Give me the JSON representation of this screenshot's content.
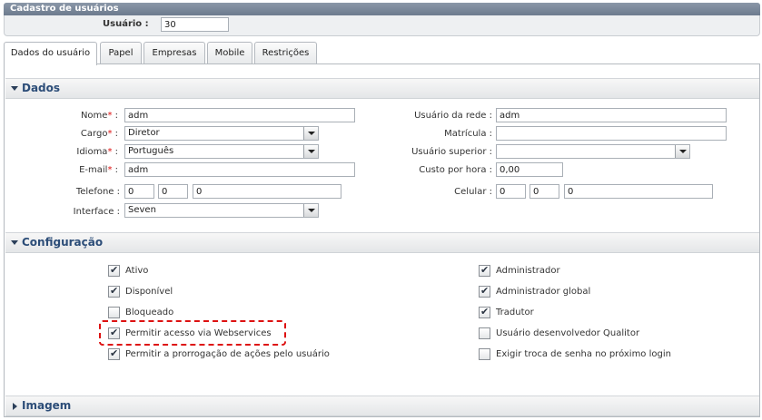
{
  "window": {
    "title": "Cadastro de usuários"
  },
  "userbar": {
    "label": "Usuário :",
    "value": "30"
  },
  "tabs": [
    {
      "label": "Dados do usuário",
      "active": true
    },
    {
      "label": "Papel"
    },
    {
      "label": "Empresas"
    },
    {
      "label": "Mobile"
    },
    {
      "label": "Restrições"
    }
  ],
  "sections": {
    "dados": {
      "title": "Dados"
    },
    "config": {
      "title": "Configuração"
    },
    "imagem": {
      "title": "Imagem"
    }
  },
  "form": {
    "nome": {
      "label": "Nome",
      "value": "adm"
    },
    "cargo": {
      "label": "Cargo",
      "value": "Diretor"
    },
    "idioma": {
      "label": "Idioma",
      "value": "Português"
    },
    "email": {
      "label": "E-mail",
      "value": "adm"
    },
    "telefone": {
      "label": "Telefone :",
      "v1": "0",
      "v2": "0",
      "v3": "0"
    },
    "interface": {
      "label": "Interface :",
      "value": "Seven"
    },
    "usuario_rede": {
      "label": "Usuário da rede :",
      "value": "adm"
    },
    "matricula": {
      "label": "Matrícula :",
      "value": ""
    },
    "usuario_superior": {
      "label": "Usuário superior :",
      "value": ""
    },
    "custo_hora": {
      "label": "Custo por hora :",
      "value": "0,00"
    },
    "celular": {
      "label": "Celular :",
      "v1": "0",
      "v2": "0",
      "v3": "0"
    }
  },
  "required_mark": "*",
  "colon": ":",
  "config": {
    "left": [
      {
        "label": "Ativo",
        "checked": true
      },
      {
        "label": "Disponível",
        "checked": true
      },
      {
        "label": "Bloqueado",
        "checked": false
      },
      {
        "label": "Permitir acesso via Webservices",
        "checked": true
      },
      {
        "label": "Permitir a prorrogação de ações pelo usuário",
        "checked": true
      }
    ],
    "right": [
      {
        "label": "Administrador",
        "checked": true
      },
      {
        "label": "Administrador global",
        "checked": true
      },
      {
        "label": "Tradutor",
        "checked": true
      },
      {
        "label": "Usuário desenvolvedor Qualitor",
        "checked": false
      },
      {
        "label": "Exigir troca de senha no próximo login",
        "checked": false
      }
    ]
  },
  "colors": {
    "accent": "#2c4d78",
    "required": "#dd1111",
    "highlight": "#dd1111"
  }
}
